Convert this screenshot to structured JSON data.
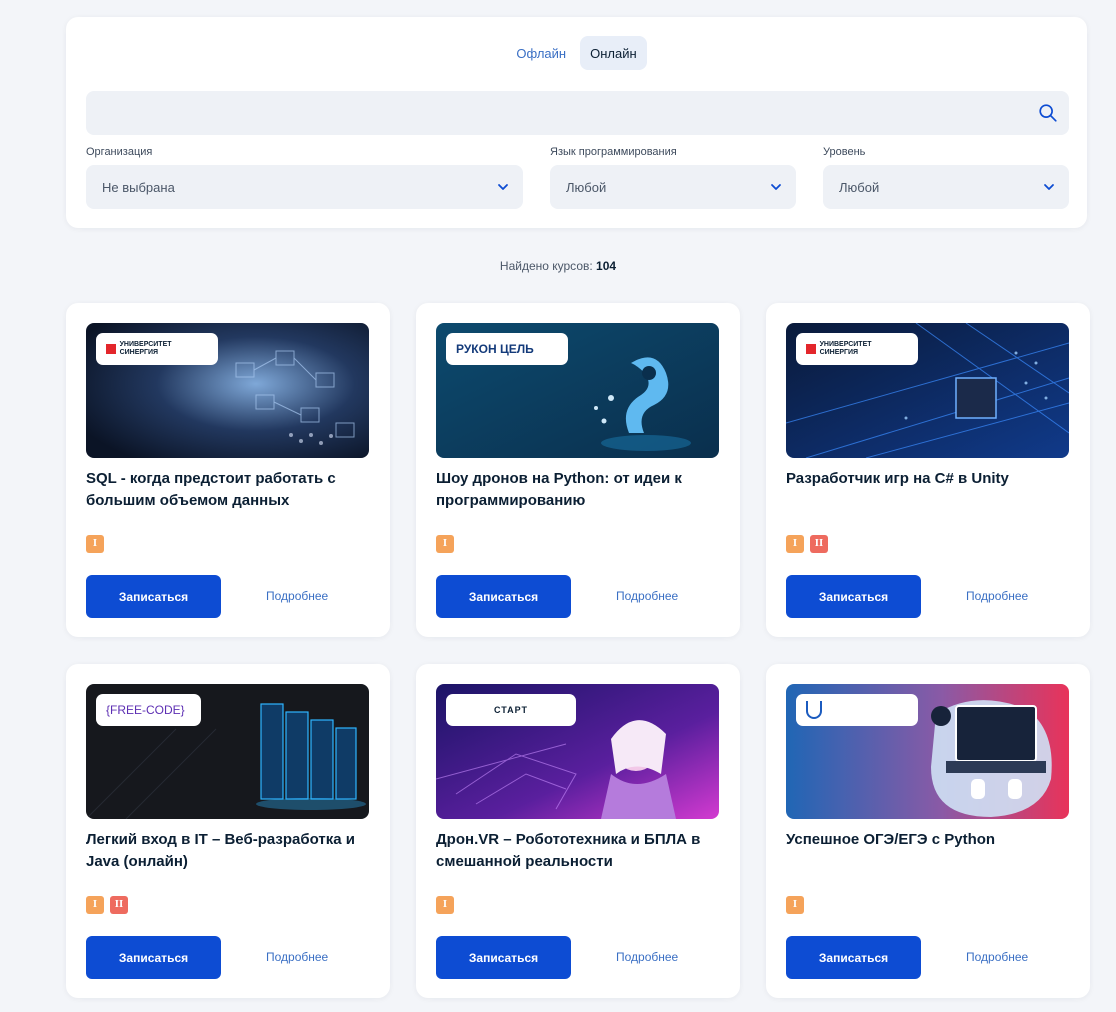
{
  "mode_tabs": [
    {
      "label": "Офлайн",
      "active": false
    },
    {
      "label": "Онлайн",
      "active": true
    }
  ],
  "search": {
    "value": "",
    "placeholder": ""
  },
  "filters": {
    "organization": {
      "label": "Организация",
      "value": "Не выбрана"
    },
    "language": {
      "label": "Язык программирования",
      "value": "Любой"
    },
    "level": {
      "label": "Уровень",
      "value": "Любой"
    }
  },
  "results": {
    "label": "Найдено курсов:",
    "count": "104"
  },
  "course_cards": [
    {
      "title": "SQL - когда предстоит работать с большим объемом данных",
      "logo": "УНИВЕРСИТЕТ СИНЕРГИЯ",
      "levels": [
        "I"
      ],
      "enroll": "Записаться",
      "more": "Подробнее"
    },
    {
      "title": "Шоу дронов на Python: от идеи к программированию",
      "logo": "РУКОН ЦЕЛЬ",
      "levels": [
        "I"
      ],
      "enroll": "Записаться",
      "more": "Подробнее"
    },
    {
      "title": "Разработчик игр на C# в Unity",
      "logo": "УНИВЕРСИТЕТ СИНЕРГИЯ",
      "levels": [
        "I",
        "II"
      ],
      "enroll": "Записаться",
      "more": "Подробнее"
    },
    {
      "title": "Легкий вход в IT – Веб-разработка и Java (онлайн)",
      "logo": "{FREE-CODE}",
      "levels": [
        "I",
        "II"
      ],
      "enroll": "Записаться",
      "more": "Подробнее"
    },
    {
      "title": "Дрон.VR – Робототехника и БПЛА в смешанной реальности",
      "logo": "СТАРТ",
      "levels": [
        "I"
      ],
      "enroll": "Записаться",
      "more": "Подробнее"
    },
    {
      "title": "Успешное ОГЭ/ЕГЭ с Python",
      "logo": "",
      "levels": [
        "I"
      ],
      "enroll": "Записаться",
      "more": "Подробнее"
    }
  ],
  "colors": {
    "primary": "#0d4cd3",
    "link": "#3a6fc4",
    "level_1": "#f5a35a",
    "level_2": "#ee6b5f",
    "background": "#f3f5f9"
  }
}
